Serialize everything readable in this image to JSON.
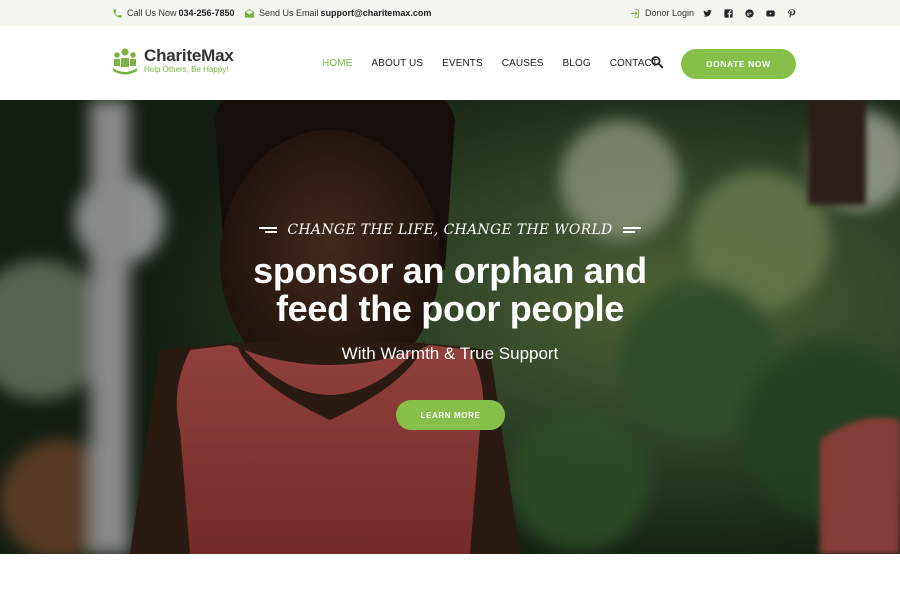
{
  "topbar": {
    "call_label": "Call Us Now",
    "call_value": "034-256-7850",
    "email_label": "Send Us Email",
    "email_value": "support@charitemax.com",
    "login_label": "Donor Login",
    "social": [
      "twitter-icon",
      "facebook-icon",
      "google-plus-icon",
      "youtube-icon",
      "pinterest-icon"
    ]
  },
  "header": {
    "brand": "ChariteMax",
    "tagline": "Help Others, Be Happy!",
    "nav": [
      "HOME",
      "ABOUT US",
      "EVENTS",
      "CAUSES",
      "BLOG",
      "CONTACT"
    ],
    "active_nav": "HOME",
    "donate_label": "DONATE NOW"
  },
  "hero": {
    "kicker": "CHANGE THE LIFE, CHANGE THE WORLD",
    "headline_line1": "sponsor an orphan and",
    "headline_line2": "feed the poor people",
    "subheadline": "With Warmth & True Support",
    "cta_label": "LEARN MORE"
  },
  "colors": {
    "accent": "#86c04a",
    "accent_text": "#7cb342",
    "topbar_bg": "#f4f6ef"
  }
}
